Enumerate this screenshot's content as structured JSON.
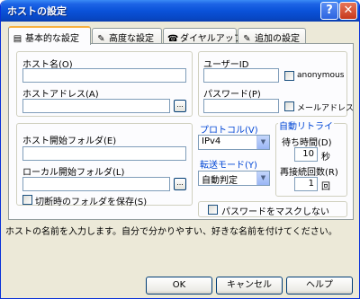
{
  "window": {
    "title": "ホストの設定",
    "help_btn": "?",
    "close_btn": "✕"
  },
  "tabs": [
    {
      "label": "基本的な設定",
      "icon": "▤"
    },
    {
      "label": "高度な設定",
      "icon": "✎"
    },
    {
      "label": "ダイヤルアップ",
      "icon": "☎"
    },
    {
      "label": "追加の設定",
      "icon": "✎"
    }
  ],
  "host": {
    "name_label": "ホスト名(O)",
    "name_value": "",
    "address_label": "ホストアドレス(A)",
    "address_value": "",
    "browse": "..."
  },
  "user": {
    "id_label": "ユーザーID",
    "id_value": "",
    "anonymous_label": "anonymous",
    "password_label": "パスワード(P)",
    "password_value": "",
    "mail_label": "メールアドレス"
  },
  "folders": {
    "host_label": "ホスト開始フォルダ(E)",
    "host_value": "",
    "local_label": "ローカル開始フォルダ(L)",
    "local_value": "",
    "browse": "...",
    "save_label": "切断時のフォルダを保存(S)"
  },
  "protocol": {
    "label": "プロトコル(V)",
    "value": "IPv4"
  },
  "transfer": {
    "label": "転送モード(Y)",
    "value": "自動判定"
  },
  "retry": {
    "label": "自動リトライ",
    "wait_label": "待ち時間(D)",
    "wait_value": "10",
    "wait_unit": "秒",
    "count_label": "再接続回数(R)",
    "count_value": "1",
    "count_unit": "回"
  },
  "mask_label": "パスワードをマスクしない",
  "status_text": "ホストの名前を入力します。自分で分かりやすい、好きな名前を付けてください。",
  "buttons": {
    "ok": "OK",
    "cancel": "キャンセル",
    "help": "ヘルプ"
  }
}
